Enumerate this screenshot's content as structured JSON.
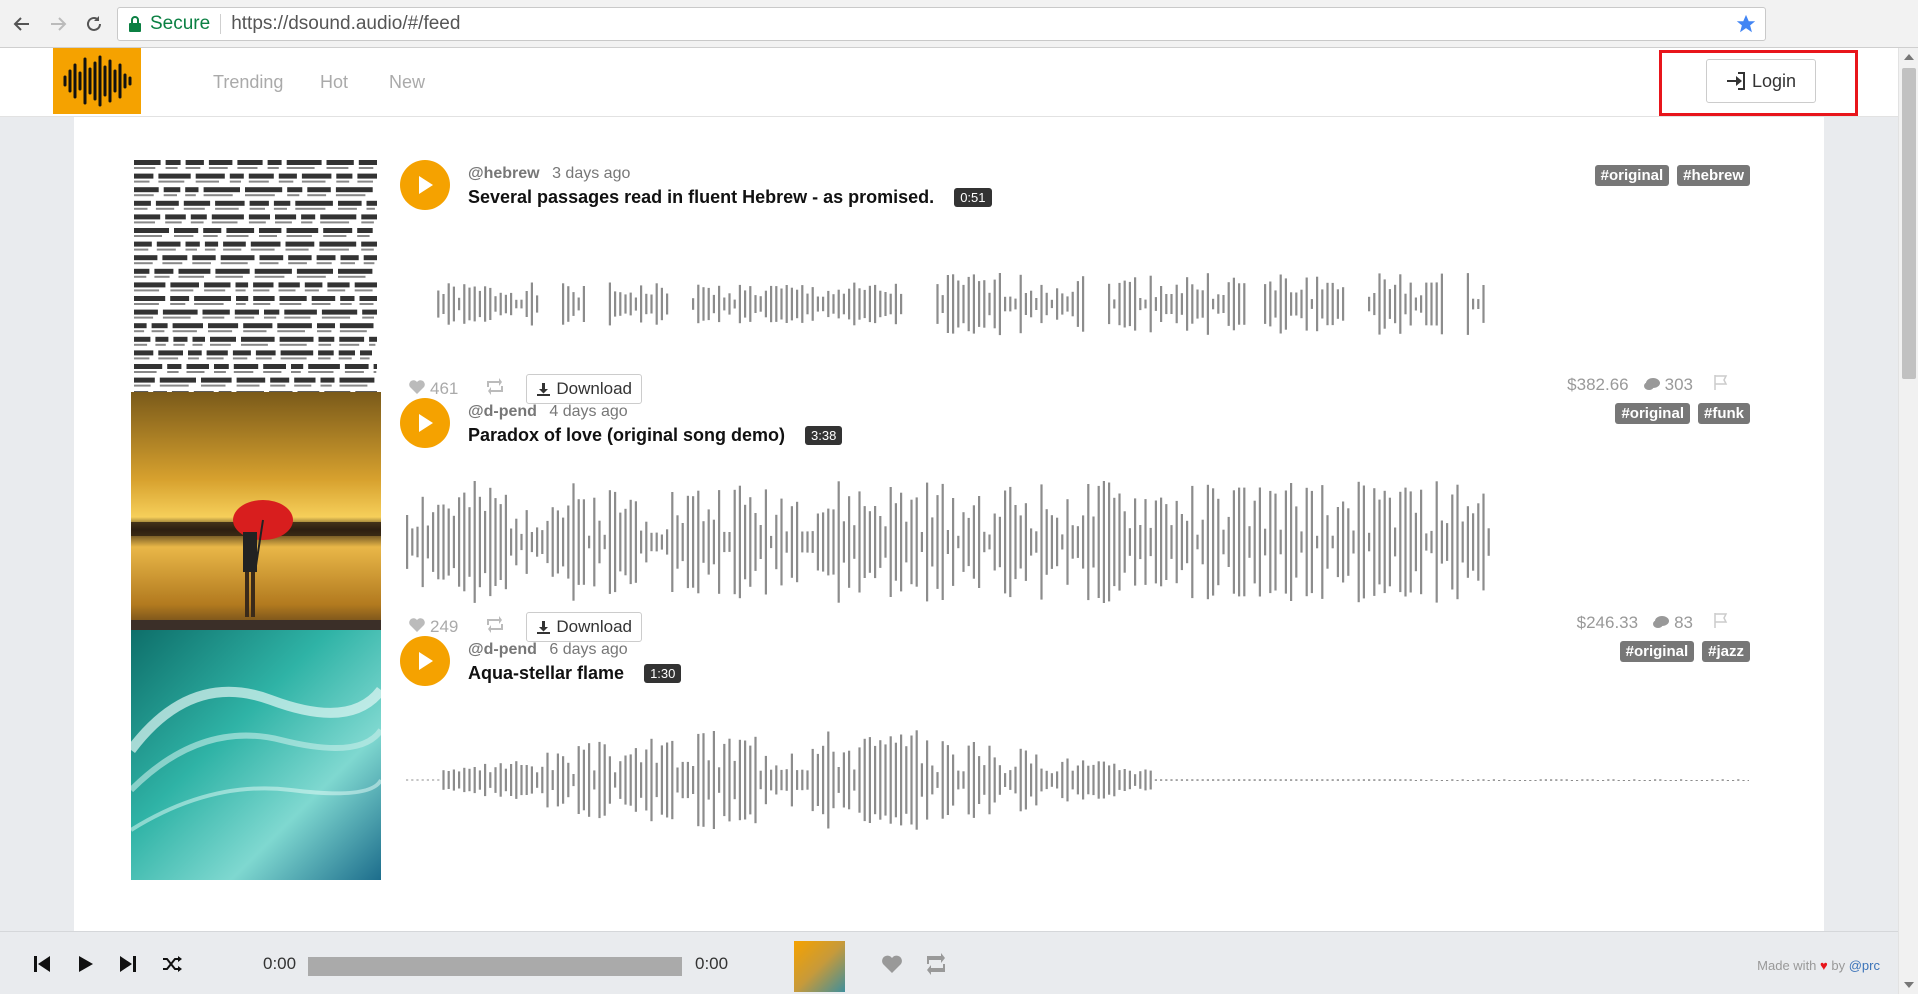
{
  "browser": {
    "secure_label": "Secure",
    "url": "https://dsound.audio/#/feed"
  },
  "header": {
    "nav": [
      "Trending",
      "Hot",
      "New"
    ],
    "login_label": "Login",
    "brand_color": "#f5a200"
  },
  "tracks": [
    {
      "author": "@hebrew",
      "ago": "3 days ago",
      "title": "Several passages read in fluent Hebrew - as promised.",
      "duration": "0:51",
      "tags": [
        "#original",
        "#hebrew"
      ],
      "likes": "461",
      "payout": "$382.66",
      "comments": "303",
      "download_label": "Download",
      "cover": "hebrew-text-page"
    },
    {
      "author": "@d-pend",
      "ago": "4 days ago",
      "title": "Paradox of love (original song demo)",
      "duration": "3:38",
      "tags": [
        "#original",
        "#funk"
      ],
      "likes": "249",
      "payout": "$246.33",
      "comments": "83",
      "download_label": "Download",
      "cover": "woman-red-umbrella-sunset"
    },
    {
      "author": "@d-pend",
      "ago": "6 days ago",
      "title": "Aqua-stellar flame",
      "duration": "1:30",
      "tags": [
        "#original",
        "#jazz"
      ],
      "cover": "teal-wave-painting"
    }
  ],
  "player": {
    "elapsed": "0:00",
    "total": "0:00",
    "footer_prefix": "Made with",
    "footer_by": "by",
    "footer_author": "@prc"
  }
}
